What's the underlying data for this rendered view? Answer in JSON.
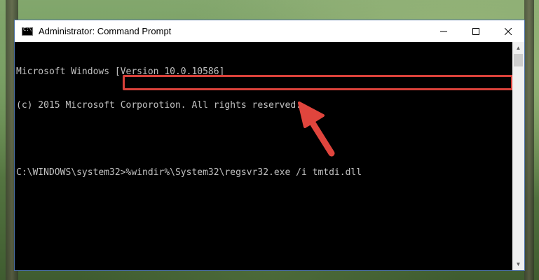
{
  "window": {
    "title": "Administrator: Command Prompt",
    "controls": {
      "minimize": "minimize-icon",
      "maximize": "maximize-icon",
      "close": "close-icon"
    }
  },
  "console": {
    "lines": [
      "Microsoft Windows [Version 10.0.10586]",
      "(c) 2015 Microsoft Corporotion. All rights reserved.",
      "",
      "C:\\WINDOWS\\system32>%windir%\\System32\\regsvr32.exe /i tmtdi.dll"
    ]
  },
  "annotation": {
    "highlight_color": "#d9413a",
    "arrow_color": "#e0453d"
  }
}
